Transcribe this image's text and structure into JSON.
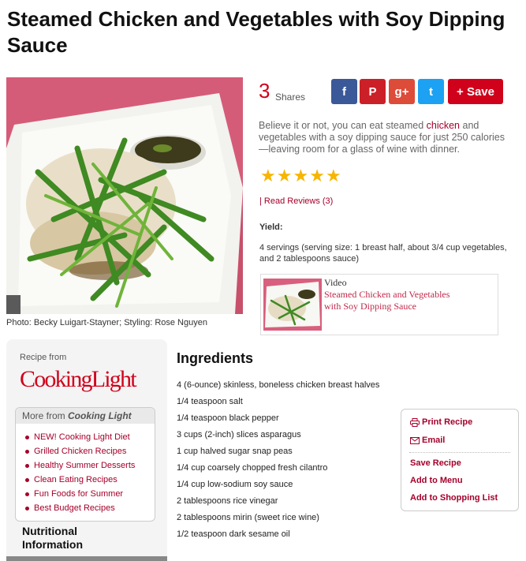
{
  "recipe": {
    "title": "Steamed Chicken and Vegetables with Soy Dipping Sauce",
    "photo_credit": "Photo: Becky Luigart-Stayner; Styling: Rose Nguyen"
  },
  "shares": {
    "count": "3",
    "label": "Shares",
    "buttons": [
      {
        "name": "facebook",
        "glyph": "f",
        "color": "#3b5998"
      },
      {
        "name": "pinterest",
        "glyph": "P",
        "color": "#cb2027"
      },
      {
        "name": "google-plus",
        "glyph": "g+",
        "color": "#dd4b39"
      },
      {
        "name": "twitter",
        "glyph": "t",
        "color": "#1da1f2"
      }
    ],
    "save_label": "+ Save"
  },
  "description": {
    "before": "Believe it or not, you can eat steamed ",
    "link": "chicken",
    "after": " and vegetables with a soy dipping sauce for just 250 calories—leaving room for a glass of wine with dinner."
  },
  "rating": {
    "stars": 5,
    "max": 5
  },
  "reviews_link": "| Read Reviews (3)",
  "yield": {
    "heading": "Yield:",
    "value": "4 servings (serving size: 1 breast half, about 3/4 cup vegetables, and 2 tablespoons sauce)"
  },
  "video": {
    "tag": "Video",
    "title": "Steamed Chicken and Vegetables with Soy Dipping Sauce"
  },
  "sidebar": {
    "recipe_from": "Recipe from",
    "brand": "CookingLight",
    "more_prefix": "More from ",
    "more_brand": "Cooking Light",
    "links": [
      "NEW! Cooking Light Diet",
      "Grilled Chicken Recipes",
      "Healthy Summer Desserts",
      "Clean Eating Recipes",
      "Fun Foods for Summer",
      "Best Budget Recipes"
    ],
    "nutrition_heading": "Nutritional Information"
  },
  "ingredients": {
    "heading": "Ingredients",
    "items": [
      "4 (6-ounce) skinless, boneless chicken breast halves",
      "1/4 teaspoon salt",
      "1/4 teaspoon black pepper",
      "3 cups (2-inch) slices asparagus",
      "1 cup halved sugar snap peas",
      "1/4 cup coarsely chopped fresh cilantro",
      "1/4 cup low-sodium soy sauce",
      "2 tablespoons rice vinegar",
      "2 tablespoons mirin (sweet rice wine)",
      "1/2 teaspoon dark sesame oil"
    ]
  },
  "actions": {
    "print": "Print Recipe",
    "email": "Email",
    "save_recipe": "Save Recipe",
    "add_menu": "Add to Menu",
    "add_list": "Add to Shopping List"
  },
  "colors": {
    "accent": "#d0021b",
    "link": "#a5002a",
    "star": "#f7b500"
  }
}
